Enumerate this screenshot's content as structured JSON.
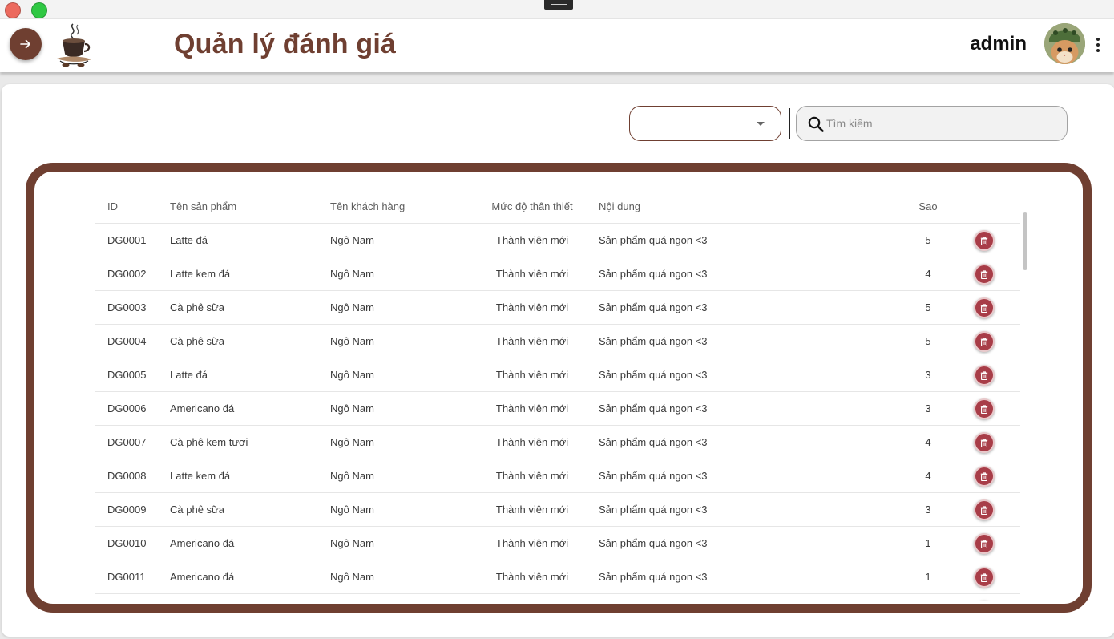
{
  "window": {
    "close_icon": "close-dot-icon",
    "maximize_icon": "maximize-dot-icon"
  },
  "header": {
    "nav_icon": "arrow-right-icon",
    "logo_icon": "coffee-cup-logo-icon",
    "title": "Quản lý đánh giá",
    "username": "admin",
    "avatar_icon": "avatar-cat-icon",
    "more_icon": "more-vertical-icon",
    "accent_color": "#6f3f31"
  },
  "filter": {
    "selected_value": "",
    "caret_icon": "caret-down-icon"
  },
  "search": {
    "placeholder": "Tìm kiếm",
    "value": "",
    "icon": "search-icon"
  },
  "table": {
    "columns": [
      "ID",
      "Tên sản phẩm",
      "Tên khách hàng",
      "Mức độ thân thiết",
      "Nội dung",
      "Sao"
    ],
    "delete_icon": "trash-icon",
    "delete_color": "#a83d48",
    "rows": [
      {
        "id": "DG0001",
        "product": "Latte đá",
        "customer": "Ngô Nam",
        "level": "Thành viên mới",
        "content": "Sản phẩm quá ngon <3",
        "stars": "5"
      },
      {
        "id": "DG0002",
        "product": "Latte kem đá",
        "customer": "Ngô Nam",
        "level": "Thành viên mới",
        "content": "Sản phẩm quá ngon <3",
        "stars": "4"
      },
      {
        "id": "DG0003",
        "product": "Cà phê sữa",
        "customer": "Ngô Nam",
        "level": "Thành viên mới",
        "content": "Sản phẩm quá ngon <3",
        "stars": "5"
      },
      {
        "id": "DG0004",
        "product": "Cà phê sữa",
        "customer": "Ngô Nam",
        "level": "Thành viên mới",
        "content": "Sản phẩm quá ngon <3",
        "stars": "5"
      },
      {
        "id": "DG0005",
        "product": "Latte đá",
        "customer": "Ngô Nam",
        "level": "Thành viên mới",
        "content": "Sản phẩm quá ngon <3",
        "stars": "3"
      },
      {
        "id": "DG0006",
        "product": "Americano đá",
        "customer": "Ngô Nam",
        "level": "Thành viên mới",
        "content": "Sản phẩm quá ngon <3",
        "stars": "3"
      },
      {
        "id": "DG0007",
        "product": "Cà phê kem tươi",
        "customer": "Ngô Nam",
        "level": "Thành viên mới",
        "content": "Sản phẩm quá ngon <3",
        "stars": "4"
      },
      {
        "id": "DG0008",
        "product": "Latte kem đá",
        "customer": "Ngô Nam",
        "level": "Thành viên mới",
        "content": "Sản phẩm quá ngon <3",
        "stars": "4"
      },
      {
        "id": "DG0009",
        "product": "Cà phê sữa",
        "customer": "Ngô Nam",
        "level": "Thành viên mới",
        "content": "Sản phẩm quá ngon <3",
        "stars": "3"
      },
      {
        "id": "DG0010",
        "product": "Americano đá",
        "customer": "Ngô Nam",
        "level": "Thành viên mới",
        "content": "Sản phẩm quá ngon <3",
        "stars": "1"
      },
      {
        "id": "DG0011",
        "product": "Americano đá",
        "customer": "Ngô Nam",
        "level": "Thành viên mới",
        "content": "Sản phẩm quá ngon <3",
        "stars": "1"
      }
    ]
  }
}
